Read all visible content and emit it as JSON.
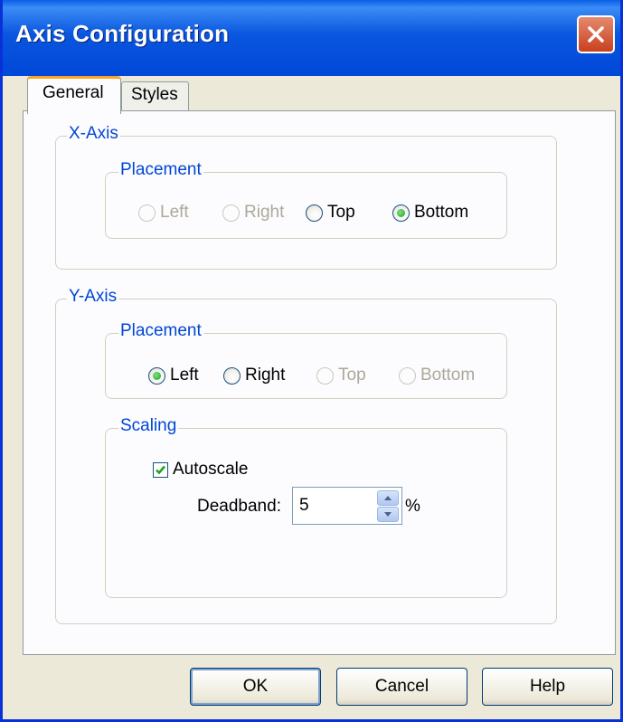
{
  "window": {
    "title": "Axis Configuration",
    "close_icon": "close-icon"
  },
  "tabs": [
    {
      "label": "General",
      "selected": true
    },
    {
      "label": "Styles",
      "selected": false
    }
  ],
  "x_axis": {
    "legend": "X-Axis",
    "placement": {
      "legend": "Placement",
      "options": [
        {
          "label": "Left",
          "enabled": false,
          "checked": false
        },
        {
          "label": "Right",
          "enabled": false,
          "checked": false
        },
        {
          "label": "Top",
          "enabled": true,
          "checked": false
        },
        {
          "label": "Bottom",
          "enabled": true,
          "checked": true
        }
      ]
    }
  },
  "y_axis": {
    "legend": "Y-Axis",
    "placement": {
      "legend": "Placement",
      "options": [
        {
          "label": "Left",
          "enabled": true,
          "checked": true
        },
        {
          "label": "Right",
          "enabled": true,
          "checked": false
        },
        {
          "label": "Top",
          "enabled": false,
          "checked": false
        },
        {
          "label": "Bottom",
          "enabled": false,
          "checked": false
        }
      ]
    },
    "scaling": {
      "legend": "Scaling",
      "autoscale_label": "Autoscale",
      "autoscale_checked": true,
      "deadband_label": "Deadband:",
      "deadband_value": "5",
      "deadband_unit": "%"
    }
  },
  "buttons": {
    "ok": "OK",
    "cancel": "Cancel",
    "help": "Help"
  },
  "colors": {
    "titlebar": "#0a56df",
    "group_label": "#0046d5",
    "disabled_text": "#aca899",
    "radio_dot": "#21a121"
  }
}
